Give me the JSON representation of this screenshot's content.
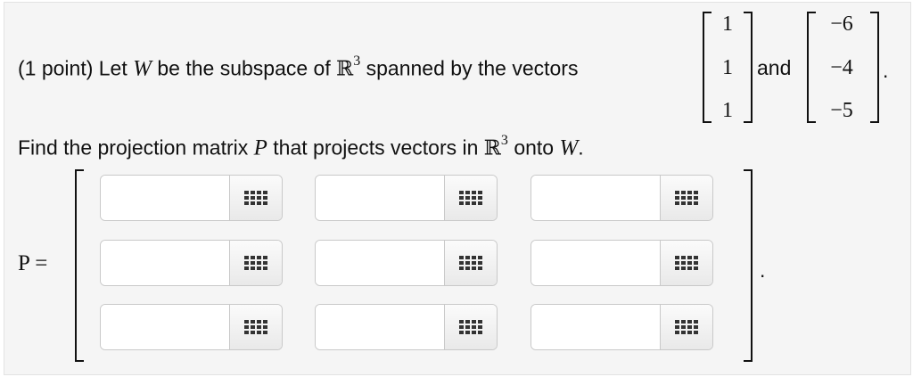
{
  "problem": {
    "points_label": "(1 point)",
    "let_text": "Let",
    "W": "W",
    "be_text": "be the subspace of",
    "R": "ℝ",
    "exp": "3",
    "spanned_text": "spanned by the vectors",
    "and_text": "and",
    "period": "."
  },
  "vector1": [
    "1",
    "1",
    "1"
  ],
  "vector2": [
    "−6",
    "−4",
    "−5"
  ],
  "task": {
    "find_text": "Find the projection matrix",
    "P": "P",
    "projects_text": "that projects vectors in",
    "R": "ℝ",
    "exp": "3",
    "onto_text": "onto",
    "W": "W",
    "period": "."
  },
  "matrix": {
    "label": "P =",
    "trailing_period": ".",
    "cells": [
      [
        "",
        "",
        ""
      ],
      [
        "",
        "",
        ""
      ],
      [
        "",
        "",
        ""
      ]
    ],
    "palette_icon": "grid-palette-icon"
  }
}
